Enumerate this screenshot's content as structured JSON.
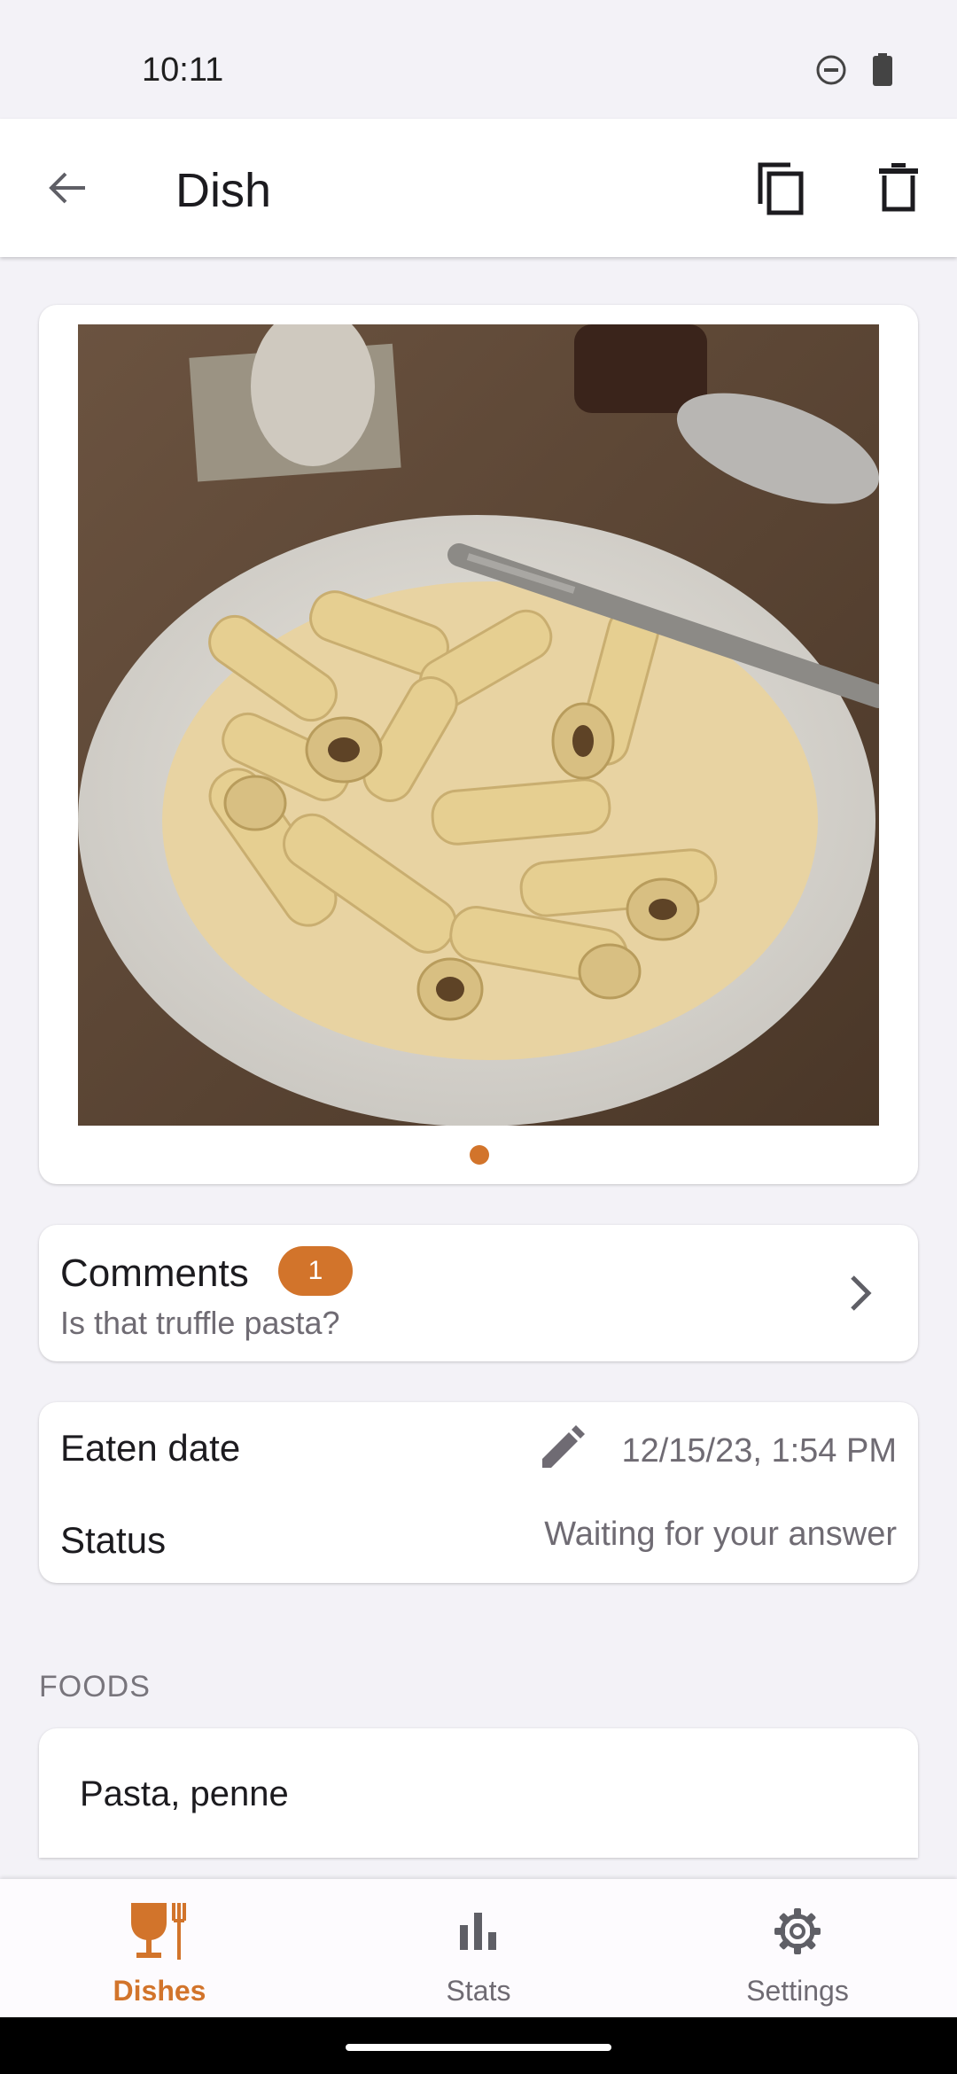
{
  "status_bar": {
    "time": "10:11"
  },
  "app_bar": {
    "title": "Dish"
  },
  "photo": {
    "page_count": 1,
    "current_page": 1
  },
  "comments": {
    "title": "Comments",
    "count": "1",
    "preview": "Is that truffle pasta?"
  },
  "details": {
    "eaten_label": "Eaten date",
    "eaten_value": "12/15/23, 1:54 PM",
    "status_label": "Status",
    "status_value": "Waiting for your answer"
  },
  "foods": {
    "header": "FOODS",
    "items": [
      "Pasta, penne"
    ]
  },
  "bottom_nav": {
    "items": [
      {
        "label": "Dishes",
        "icon": "dishes-icon",
        "active": true
      },
      {
        "label": "Stats",
        "icon": "stats-icon",
        "active": false
      },
      {
        "label": "Settings",
        "icon": "settings-icon",
        "active": false
      }
    ]
  },
  "colors": {
    "accent": "#d2742b",
    "background": "#f3f2f7",
    "surface": "#ffffff"
  }
}
